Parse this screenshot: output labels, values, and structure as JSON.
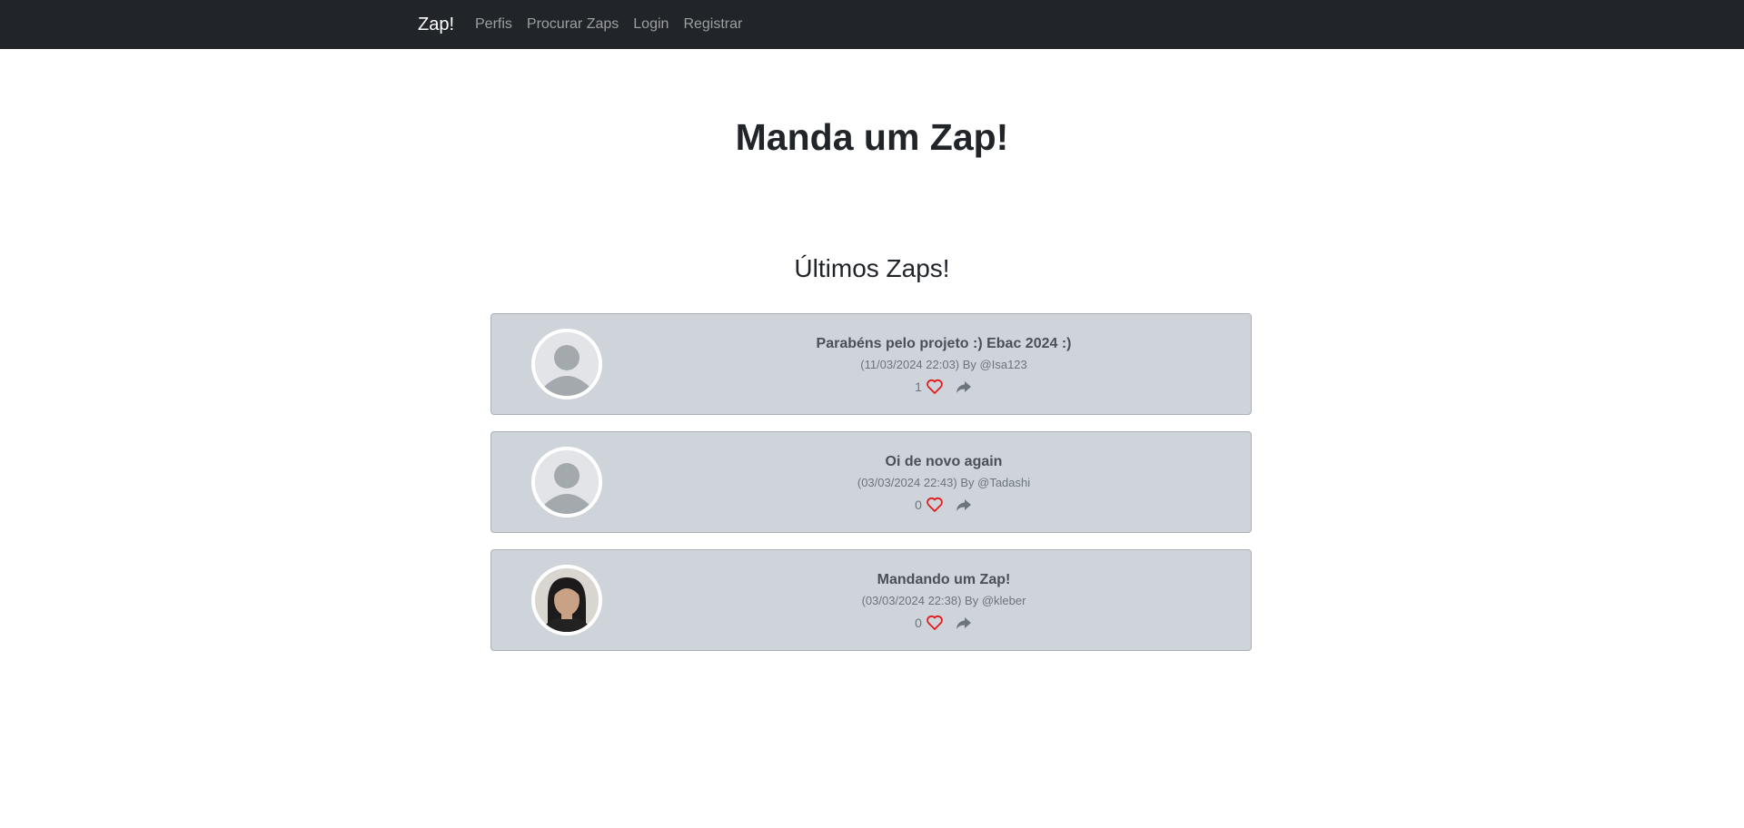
{
  "navbar": {
    "brand": "Zap!",
    "links": [
      {
        "label": "Perfis"
      },
      {
        "label": "Procurar Zaps"
      },
      {
        "label": "Login"
      },
      {
        "label": "Registrar"
      }
    ]
  },
  "hero": {
    "title": "Manda um Zap!"
  },
  "section": {
    "title": "Últimos Zaps!"
  },
  "zaps": [
    {
      "text": "Parabéns pelo projeto :) Ebac 2024 :)",
      "meta": "(11/03/2024 22:03) By @Isa123",
      "likes": "1",
      "avatar": "default-avatar-icon"
    },
    {
      "text": "Oi de novo again",
      "meta": "(03/03/2024 22:43) By @Tadashi",
      "likes": "0",
      "avatar": "default-avatar-icon"
    },
    {
      "text": "Mandando um Zap!",
      "meta": "(03/03/2024 22:38) By @kleber",
      "likes": "0",
      "avatar": "user-photo"
    }
  ],
  "colors": {
    "navbar": "#212529",
    "card": "#ced4da",
    "heart": "#e41b1b"
  }
}
